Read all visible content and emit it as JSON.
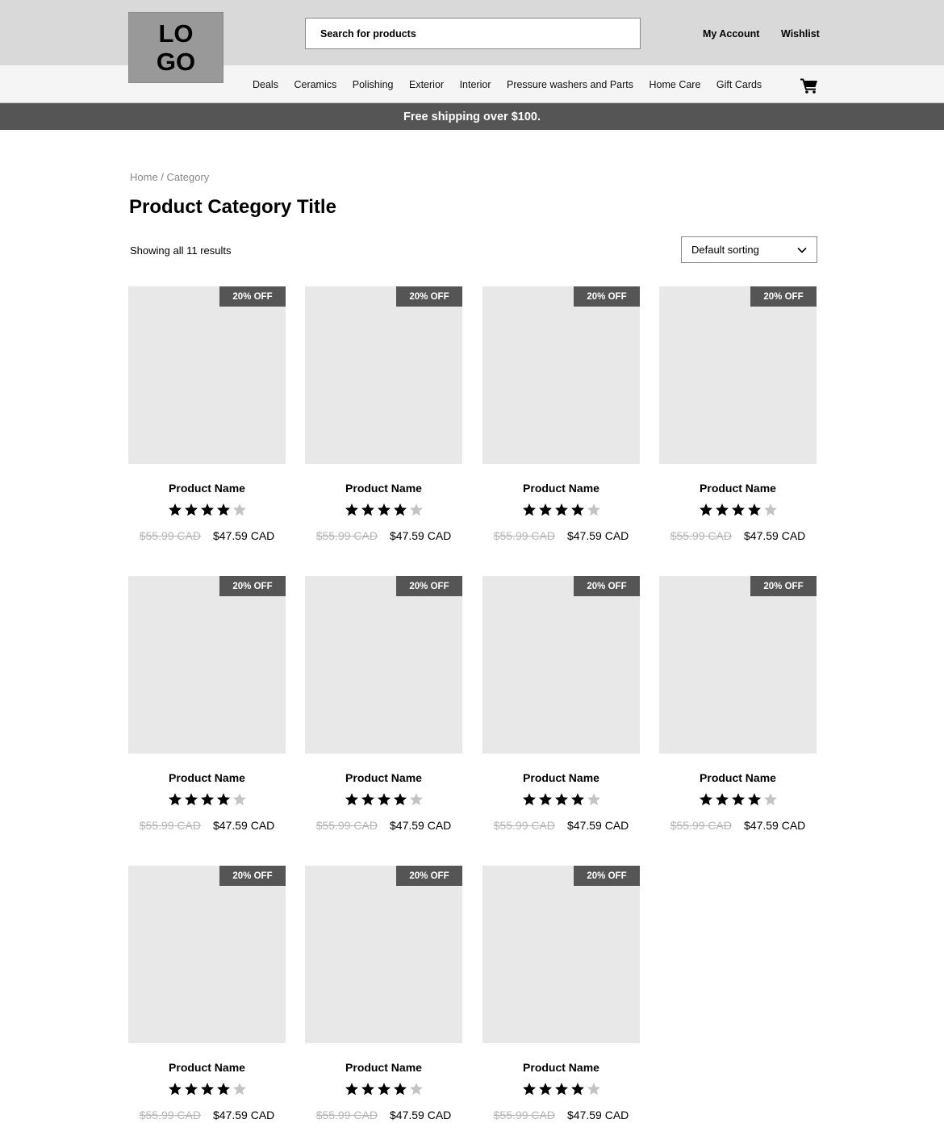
{
  "header": {
    "logo_line1": "LO",
    "logo_line2": "GO",
    "search_placeholder": "Search for products",
    "my_account": "My Account",
    "wishlist": "Wishlist",
    "cart_icon": "shopping-cart-icon"
  },
  "nav": {
    "items": [
      "Deals",
      "Ceramics",
      "Polishing",
      "Exterior",
      "Interior",
      "Pressure washers and Parts",
      "Home Care",
      "Gift Cards"
    ]
  },
  "banner": {
    "text": "Free shipping over $100."
  },
  "breadcrumb": {
    "home": "Home",
    "separator": " / ",
    "current": "Category"
  },
  "page": {
    "title": "Product Category Title",
    "results_text": "Showing all 11 results",
    "sort_selected": "Default sorting"
  },
  "colors": {
    "topbar": "#d9d9d9",
    "navbar": "#f5f5f5",
    "banner": "#555555",
    "badge": "#555555",
    "image_placeholder": "#e8e8e8",
    "star_filled": "#000000",
    "star_empty": "#c4c4c4",
    "old_price": "#b5b5b5"
  },
  "products": [
    {
      "badge": "20% OFF",
      "name": "Product Name",
      "rating": 4,
      "rating_max": 5,
      "old_price": "$55.99 CAD",
      "price": "$47.59 CAD"
    },
    {
      "badge": "20% OFF",
      "name": "Product Name",
      "rating": 4,
      "rating_max": 5,
      "old_price": "$55.99 CAD",
      "price": "$47.59 CAD"
    },
    {
      "badge": "20% OFF",
      "name": "Product Name",
      "rating": 4,
      "rating_max": 5,
      "old_price": "$55.99 CAD",
      "price": "$47.59 CAD"
    },
    {
      "badge": "20% OFF",
      "name": "Product Name",
      "rating": 4,
      "rating_max": 5,
      "old_price": "$55.99 CAD",
      "price": "$47.59 CAD"
    },
    {
      "badge": "20% OFF",
      "name": "Product Name",
      "rating": 4,
      "rating_max": 5,
      "old_price": "$55.99 CAD",
      "price": "$47.59 CAD"
    },
    {
      "badge": "20% OFF",
      "name": "Product Name",
      "rating": 4,
      "rating_max": 5,
      "old_price": "$55.99 CAD",
      "price": "$47.59 CAD"
    },
    {
      "badge": "20% OFF",
      "name": "Product Name",
      "rating": 4,
      "rating_max": 5,
      "old_price": "$55.99 CAD",
      "price": "$47.59 CAD"
    },
    {
      "badge": "20% OFF",
      "name": "Product Name",
      "rating": 4,
      "rating_max": 5,
      "old_price": "$55.99 CAD",
      "price": "$47.59 CAD"
    },
    {
      "badge": "20% OFF",
      "name": "Product Name",
      "rating": 4,
      "rating_max": 5,
      "old_price": "$55.99 CAD",
      "price": "$47.59 CAD"
    },
    {
      "badge": "20% OFF",
      "name": "Product Name",
      "rating": 4,
      "rating_max": 5,
      "old_price": "$55.99 CAD",
      "price": "$47.59 CAD"
    },
    {
      "badge": "20% OFF",
      "name": "Product Name",
      "rating": 4,
      "rating_max": 5,
      "old_price": "$55.99 CAD",
      "price": "$47.59 CAD"
    }
  ]
}
